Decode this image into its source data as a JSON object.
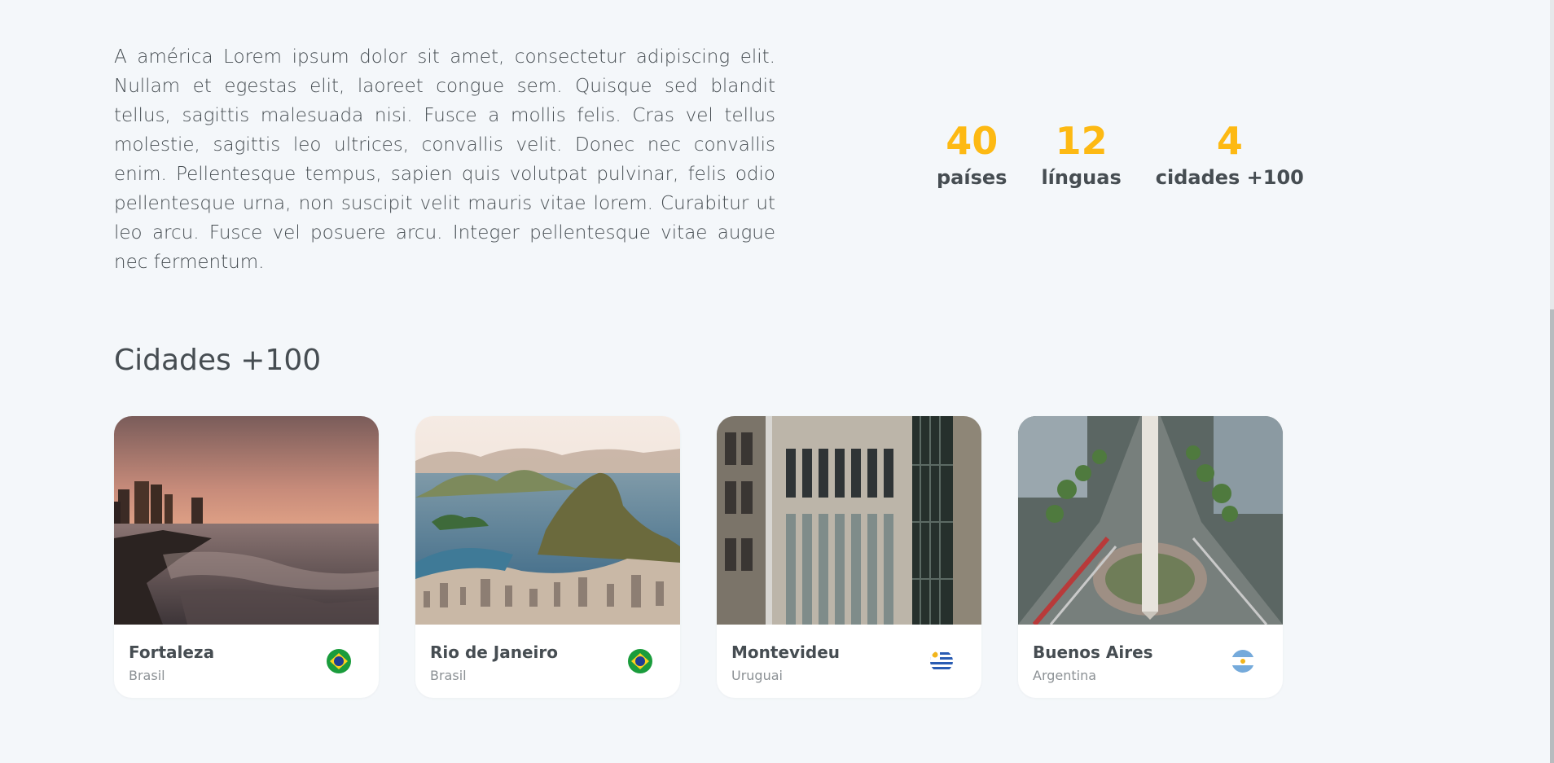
{
  "intro": {
    "text": "A américa Lorem ipsum dolor sit amet, consectetur adipiscing elit. Nullam et egestas elit, laoreet congue sem. Quisque sed blandit tellus, sagittis malesuada nisi. Fusce a mollis felis. Cras vel tellus molestie, sagittis leo ultrices, convallis velit. Donec nec convallis enim. Pellentesque tempus, sapien quis volutpat pulvinar, felis odio pellentesque urna, non suscipit velit mauris vitae lorem. Curabitur ut leo arcu. Fusce vel posuere arcu. Integer pellentesque vitae augue nec fermentum."
  },
  "stats": [
    {
      "number": "40",
      "label": "países"
    },
    {
      "number": "12",
      "label": "línguas"
    },
    {
      "number": "4",
      "label": "cidades +100"
    }
  ],
  "section": {
    "title": "Cidades +100"
  },
  "cards": [
    {
      "city": "Fortaleza",
      "country": "Brasil",
      "flag": "brazil-flag-icon"
    },
    {
      "city": "Rio de Janeiro",
      "country": "Brasil",
      "flag": "brazil-flag-icon"
    },
    {
      "city": "Montevideu",
      "country": "Uruguai",
      "flag": "uruguay-flag-icon"
    },
    {
      "city": "Buenos Aires",
      "country": "Argentina",
      "flag": "argentina-flag-icon"
    }
  ],
  "colors": {
    "accent": "#fdb913",
    "text": "#464d52",
    "muted": "#8c9195",
    "background": "#f4f7fa"
  }
}
